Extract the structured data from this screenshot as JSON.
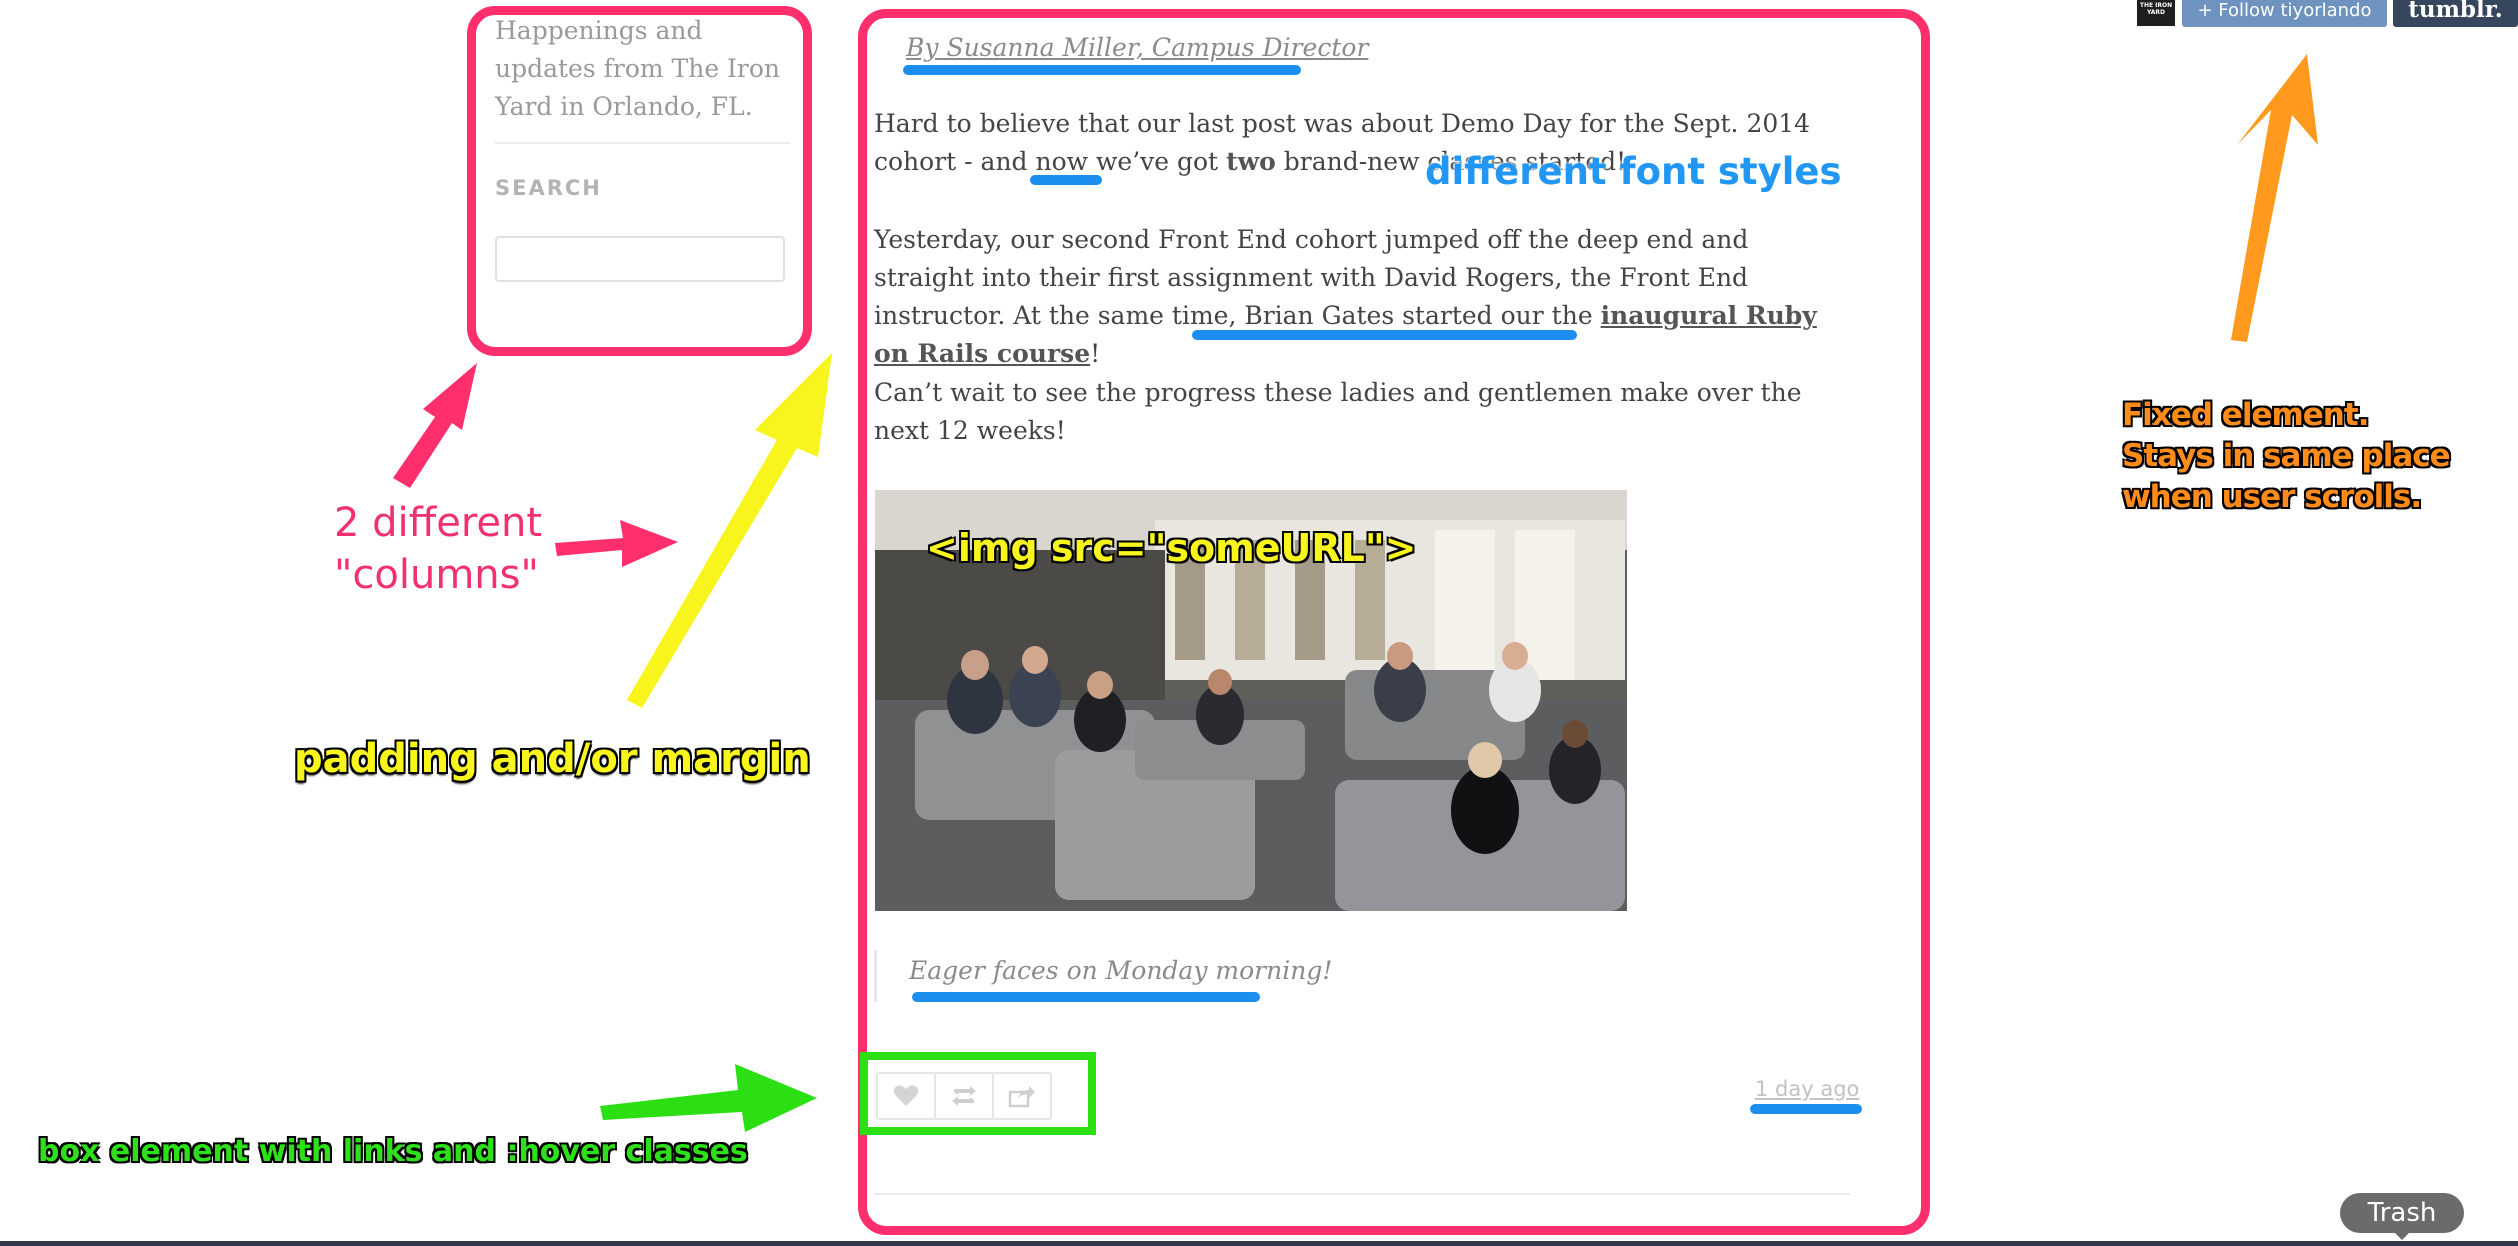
{
  "sidebar": {
    "tagline": "Happenings and updates from The Iron Yard in Orlando, FL.",
    "search_label": "SEARCH",
    "search_value": ""
  },
  "post": {
    "byline": "By Susanna Miller, Campus Director",
    "p1_before": "Hard to believe that our last post was about Demo Day for the Sept. 2014 cohort - and now we’ve got ",
    "p1_bold": "two",
    "p1_after": " brand-new classes started!",
    "p2_before": "Yesterday, our second Front End cohort jumped off the deep end and straight into their first assignment with David Rogers, the Front End instructor. At the same time, Brian Gates started our the ",
    "p2_link": "inaugural Ruby on Rails course",
    "p2_after": "!",
    "p3": "Can’t wait to see the progress these ladies and gentlemen make over the next 12 weeks!",
    "caption": "Eager faces on Monday morning!",
    "timestamp": "1 day ago",
    "actions": [
      "heart-icon",
      "reblog-icon",
      "share-icon"
    ]
  },
  "tumblr_bar": {
    "logo_text": "THE IRON YARD",
    "follow_label": "+ Follow tiyorlando",
    "tumblr_label": "tumblr."
  },
  "trash_label": "Trash",
  "annotations": {
    "font_styles": "different font styles",
    "columns": "2 different \"columns\"",
    "padding": "padding and/or margin",
    "box_element": "box element with links and :hover classes",
    "fixed_element": "Fixed element. Stays in same place when user scrolls.",
    "img_tag": "<img src=\"someURL\">"
  },
  "colors": {
    "pink": "#ff2f6e",
    "yellow": "#f7f51b",
    "green": "#2bdf13",
    "blue": "#1b8ef0",
    "orange": "#ff8c1a",
    "tumblr_blue": "#36465d",
    "follow_blue": "#6e93be"
  }
}
